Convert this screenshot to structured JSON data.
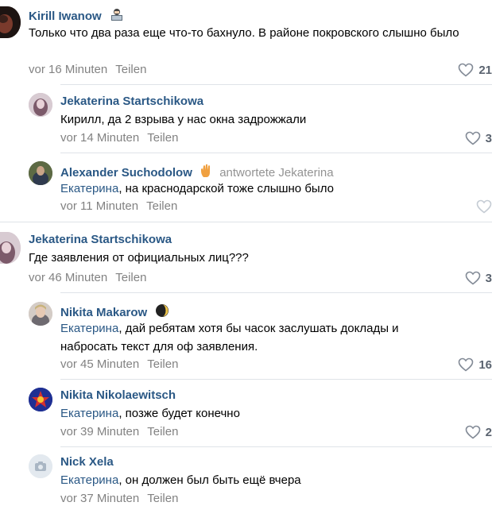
{
  "comments": [
    {
      "author": "Kirill Iwanow",
      "emoji": "",
      "replied": "",
      "mention": "",
      "text": "Только что два раза еще что-то бахнуло. В районе покровского слышно было",
      "time": "vor 16 Minuten",
      "share": "Teilen",
      "likes": "21"
    },
    {
      "author": "Jekaterina Startschikowa",
      "emoji": "",
      "replied": "",
      "mention": "",
      "text": "Кирилл, да 2 взрыва у нас окна задрожжали",
      "time": "vor 14 Minuten",
      "share": "Teilen",
      "likes": "3"
    },
    {
      "author": "Alexander Suchodolow",
      "emoji": "",
      "replied": "antwortete Jekaterina",
      "mention": "Екатерина",
      "text": ", на краснодарской тоже слышно было",
      "time": "vor 11 Minuten",
      "share": "Teilen",
      "likes": ""
    },
    {
      "author": "Jekaterina Startschikowa",
      "emoji": "",
      "replied": "",
      "mention": "",
      "text": "Где заявления от официальных лиц???",
      "time": "vor 46 Minuten",
      "share": "Teilen",
      "likes": "3"
    },
    {
      "author": "Nikita Makarow",
      "emoji": "",
      "replied": "",
      "mention": "Екатерина",
      "text": ", дай ребятам хотя бы часок заслушать доклады и набросать текст для оф заявления.",
      "time": "vor 45 Minuten",
      "share": "Teilen",
      "likes": "16"
    },
    {
      "author": "Nikita Nikolaewitsch",
      "emoji": "",
      "replied": "",
      "mention": "Екатерина",
      "text": ", позже будет конечно",
      "time": "vor 39 Minuten",
      "share": "Teilen",
      "likes": "2"
    },
    {
      "author": "Nick Xela",
      "emoji": "",
      "replied": "",
      "mention": "Екатерина",
      "text": ", он должен был быть ещё вчера",
      "time": "vor 37 Minuten",
      "share": "Teilen",
      "likes": ""
    }
  ],
  "colors": {
    "link": "#2a5885",
    "meta": "#828282",
    "divider": "#dfe3e8"
  }
}
